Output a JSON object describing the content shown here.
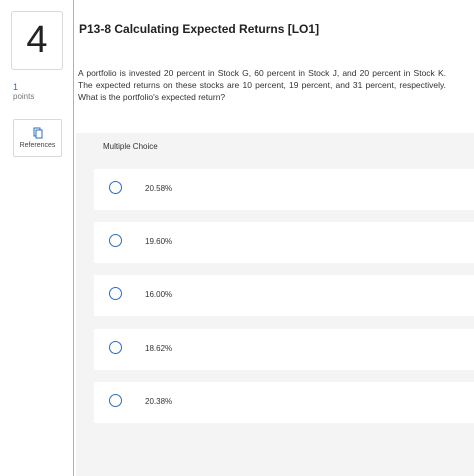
{
  "question": {
    "number": "4",
    "points_value": "1",
    "points_label": "points",
    "references_label": "References",
    "title": "P13-8 Calculating Expected Returns [LO1]",
    "text": "A portfolio is invested 20 percent in Stock G, 60 percent in Stock J, and 20 percent in Stock K. The expected returns on these stocks are 10 percent, 19 percent, and 31 percent, respectively. What is the portfolio's expected return?"
  },
  "multiple_choice": {
    "label": "Multiple Choice",
    "options": [
      "20.58%",
      "19.60%",
      "16.00%",
      "18.62%",
      "20.38%"
    ]
  },
  "colors": {
    "accent": "#2a6cc0",
    "panel": "#f4f4f4"
  }
}
